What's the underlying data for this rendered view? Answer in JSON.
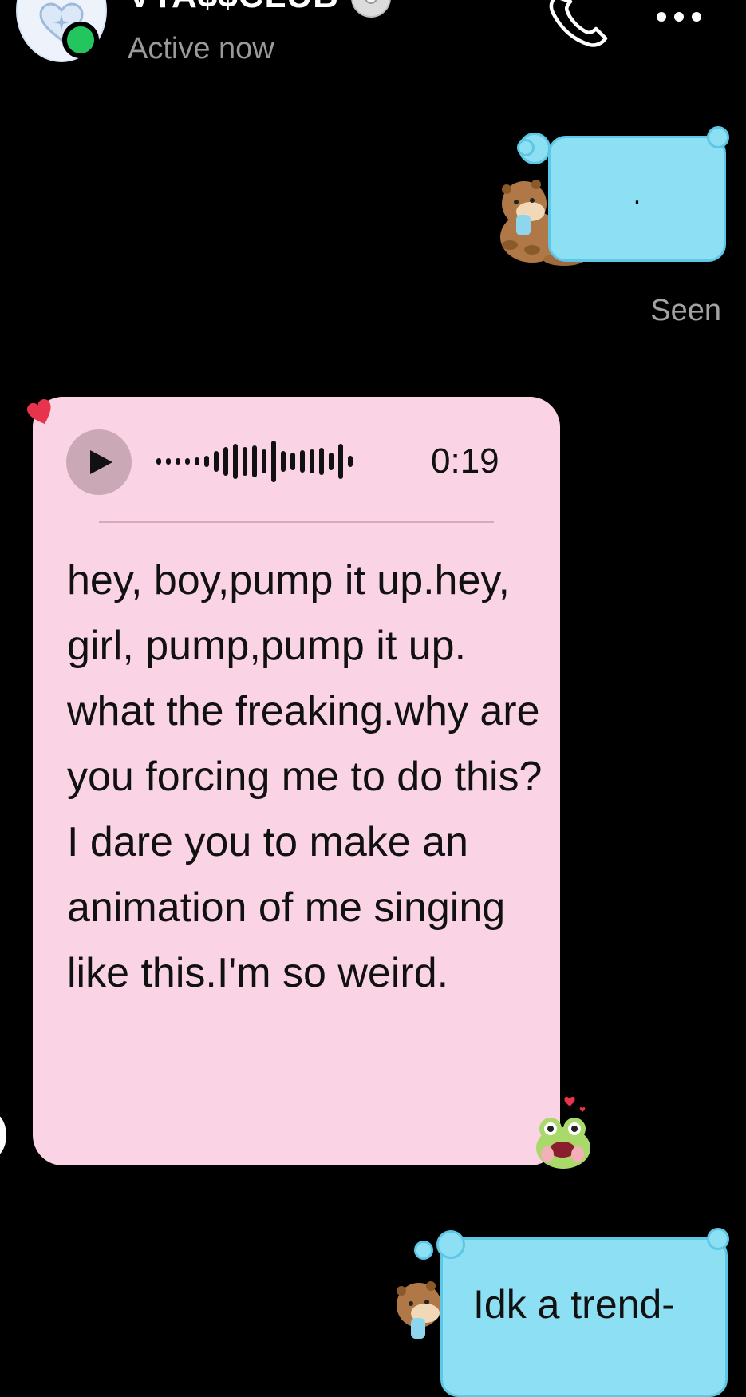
{
  "header": {
    "contact_name": "VTA$$CLUB",
    "status": "Active now",
    "icons": [
      "heart-avatar-icon",
      "phone-icon",
      "more-options-icon",
      "disc-icon"
    ]
  },
  "messages": {
    "outgoing_1": {
      "text": "."
    },
    "seen_label": "Seen",
    "incoming_voice": {
      "duration": "0:19",
      "transcript": "hey, boy,pump it up.hey, girl, pump,pump it up. what the freaking.why are you forcing me to do this?I dare you to make an animation of me singing like this.I'm so weird."
    },
    "outgoing_2": {
      "text": "Idk a trend-"
    }
  },
  "colors": {
    "background": "#000000",
    "outgoing_bubble": "#8ddff3",
    "incoming_bubble": "#fad4e4",
    "online": "#22c55e",
    "muted_text": "#9a9a9a"
  },
  "stickers": [
    "otter-sticker",
    "frog-sticker",
    "heart-sticker"
  ]
}
